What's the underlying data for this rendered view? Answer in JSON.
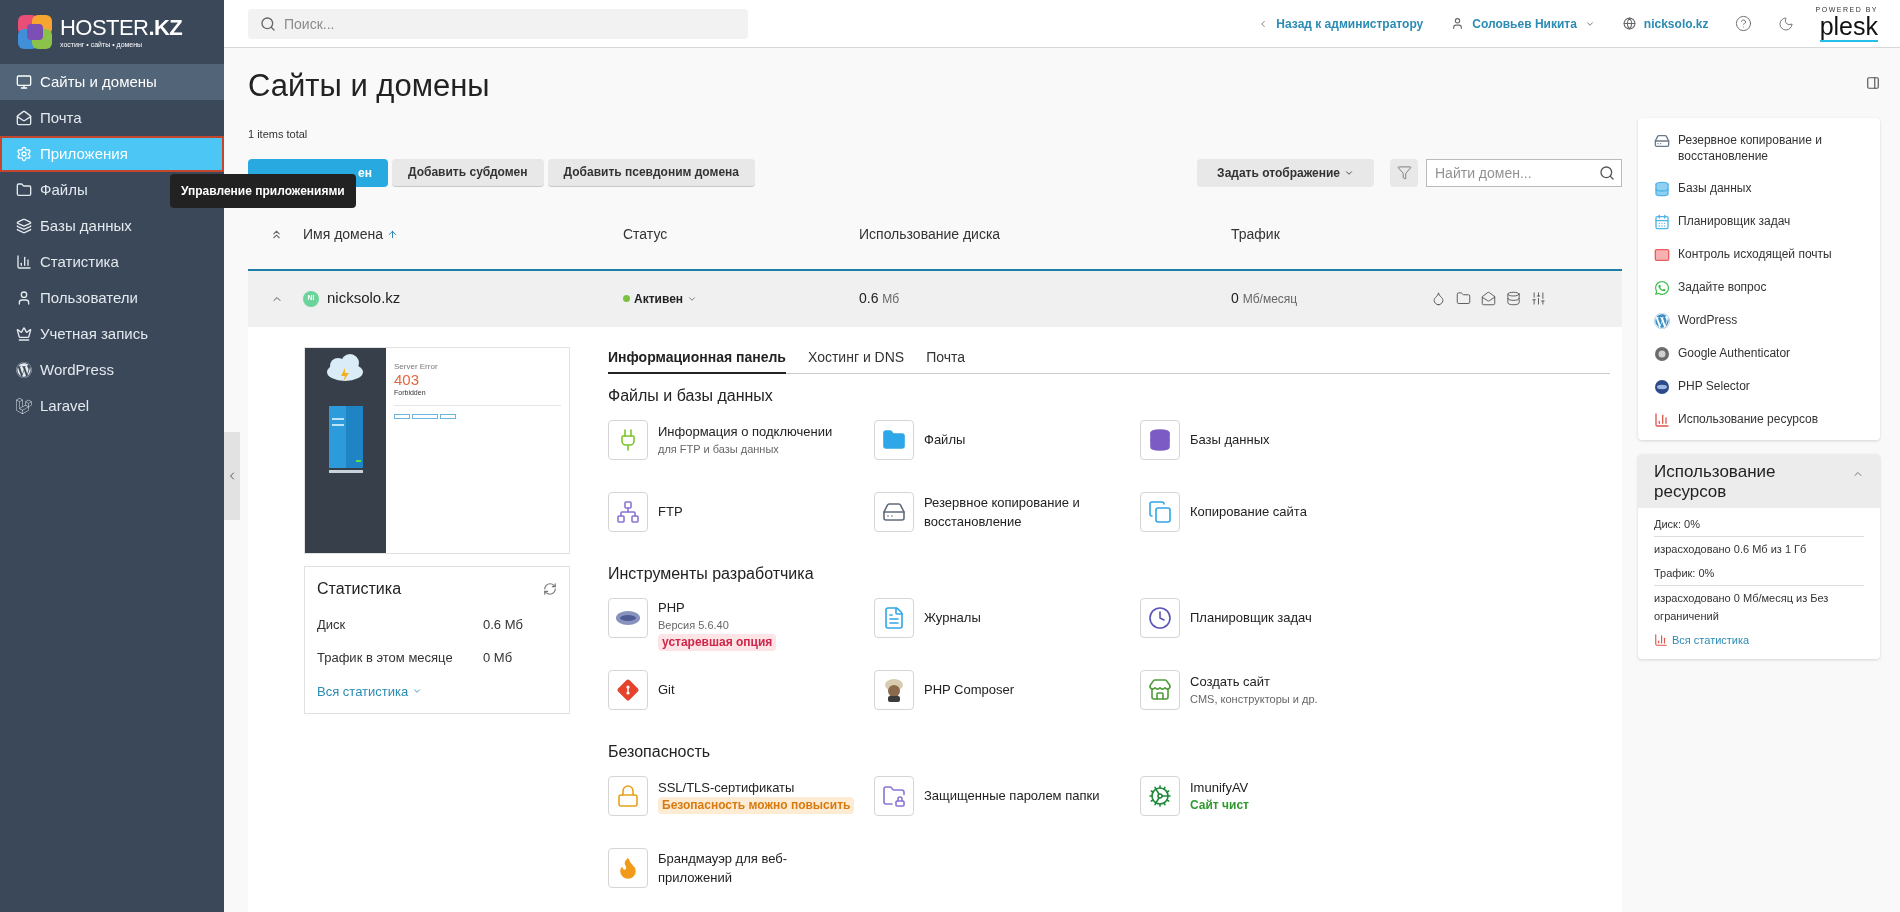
{
  "brand": {
    "name": "HOSTER",
    "name_bold": ".KZ",
    "tagline": "хостинг • сайты • домены"
  },
  "search": {
    "placeholder": "Поиск..."
  },
  "header": {
    "back_link": "Назад к администратору",
    "user": "Соловьев Никита",
    "domain": "nicksolo.kz",
    "powered_by": "POWERED BY",
    "product": "plesk"
  },
  "sidebar": {
    "items": [
      {
        "label": "Сайты и домены",
        "selected": true,
        "highlighted": false
      },
      {
        "label": "Почта",
        "selected": false,
        "highlighted": false
      },
      {
        "label": "Приложения",
        "selected": false,
        "highlighted": true
      },
      {
        "label": "Файлы",
        "selected": false,
        "highlighted": false
      },
      {
        "label": "Базы данных",
        "selected": false,
        "highlighted": false
      },
      {
        "label": "Статистика",
        "selected": false,
        "highlighted": false
      },
      {
        "label": "Пользователи",
        "selected": false,
        "highlighted": false
      },
      {
        "label": "Учетная запись",
        "selected": false,
        "highlighted": false
      },
      {
        "label": "WordPress",
        "selected": false,
        "highlighted": false
      },
      {
        "label": "Laravel",
        "selected": false,
        "highlighted": false
      }
    ]
  },
  "tooltip": "Управление приложениями",
  "page": {
    "title": "Сайты и домены",
    "count": "1 items total"
  },
  "toolbar": {
    "buttons": [
      {
        "label": "ен",
        "kind": "primary"
      },
      {
        "label": "Добавить субдомен",
        "kind": "default"
      },
      {
        "label": "Добавить псевдоним домена",
        "kind": "default"
      }
    ],
    "view_button": "Задать отображение",
    "filter_placeholder": "Найти домен..."
  },
  "table": {
    "columns": [
      {
        "label": "Имя домена",
        "sorted": true
      },
      {
        "label": "Статус",
        "sorted": false
      },
      {
        "label": "Использование диска",
        "sorted": false
      },
      {
        "label": "Трафик",
        "sorted": false
      }
    ],
    "rows": [
      {
        "avatar": "NI",
        "domain": "nicksolo.kz",
        "status": "Активен",
        "disk": "0.6",
        "disk_unit": "Мб",
        "traffic": "0",
        "traffic_unit": "Мб/месяц",
        "expanded": true
      }
    ]
  },
  "preview": {
    "kind": "picture",
    "caption": "Server Error",
    "code": "403",
    "message": "Forbidden"
  },
  "stats": {
    "title": "Статистика",
    "rows": [
      {
        "label": "Диск",
        "value": "0.6 Мб"
      },
      {
        "label": "Трафик в этом месяце",
        "value": "0 Мб"
      }
    ],
    "link": "Вся статистика"
  },
  "tabs": [
    {
      "label": "Информационная панель",
      "selected": true
    },
    {
      "label": "Хостинг и DNS",
      "selected": false
    },
    {
      "label": "Почта",
      "selected": false
    }
  ],
  "sections": [
    {
      "title": "Файлы и базы данных",
      "tools": [
        {
          "kind": "connection",
          "label": "Информация о подключении",
          "note": "для FTP и базы данных"
        },
        {
          "kind": "files",
          "label": "Файлы"
        },
        {
          "kind": "databases",
          "label": "Базы данных"
        },
        {
          "kind": "ftp",
          "label": "FTP"
        },
        {
          "kind": "backup",
          "label": "Резервное копирование и восстановление"
        },
        {
          "kind": "copy",
          "label": "Копирование сайта"
        }
      ]
    },
    {
      "title": "Инструменты разработчика",
      "tools": [
        {
          "kind": "php",
          "label": "PHP",
          "note": "Версия 5.6.40",
          "badge": {
            "text": "устаревшая опция",
            "kind": "danger"
          }
        },
        {
          "kind": "logs",
          "label": "Журналы"
        },
        {
          "kind": "scheduler",
          "label": "Планировщик задач"
        },
        {
          "kind": "git",
          "label": "Git"
        },
        {
          "kind": "composer",
          "label": "PHP Composer"
        },
        {
          "kind": "sitebuilder",
          "label": "Создать сайт",
          "note": "CMS, конструкторы и др."
        }
      ]
    },
    {
      "title": "Безопасность",
      "tools": [
        {
          "kind": "ssl",
          "label": "SSL/TLS-сертификаты",
          "badge": {
            "text": "Безопасность можно повысить",
            "kind": "warning"
          }
        },
        {
          "kind": "protected",
          "label": "Защищенные паролем папки"
        },
        {
          "kind": "imunify",
          "label": "ImunifyAV",
          "badge": {
            "text": "Сайт чист",
            "kind": "ok"
          }
        },
        {
          "kind": "firewall",
          "label": "Брандмауэр для веб-приложений"
        }
      ]
    }
  ],
  "shortcuts": [
    {
      "kind": "backup",
      "label": "Резервное копирование и восстановление"
    },
    {
      "kind": "databases",
      "label": "Базы данных"
    },
    {
      "kind": "scheduler",
      "label": "Планировщик задач"
    },
    {
      "kind": "mail",
      "label": "Контроль исходящей почты"
    },
    {
      "kind": "chat",
      "label": "Задайте вопрос"
    },
    {
      "kind": "wordpress",
      "label": "WordPress"
    },
    {
      "kind": "authenticator",
      "label": "Google Authenticator"
    },
    {
      "kind": "phpselector",
      "label": "PHP Selector"
    },
    {
      "kind": "usage",
      "label": "Использование ресурсов"
    }
  ],
  "resources": {
    "title": "Использование ресурсов",
    "expanded": true,
    "rows": [
      {
        "label": "Диск: 0%"
      },
      {
        "label": "израсходовано 0.6 Мб из 1 Гб"
      },
      {
        "label": "Трафик: 0%"
      },
      {
        "label": "израсходовано 0 Мб/месяц из Без ограничений"
      }
    ],
    "link": "Вся статистика"
  }
}
